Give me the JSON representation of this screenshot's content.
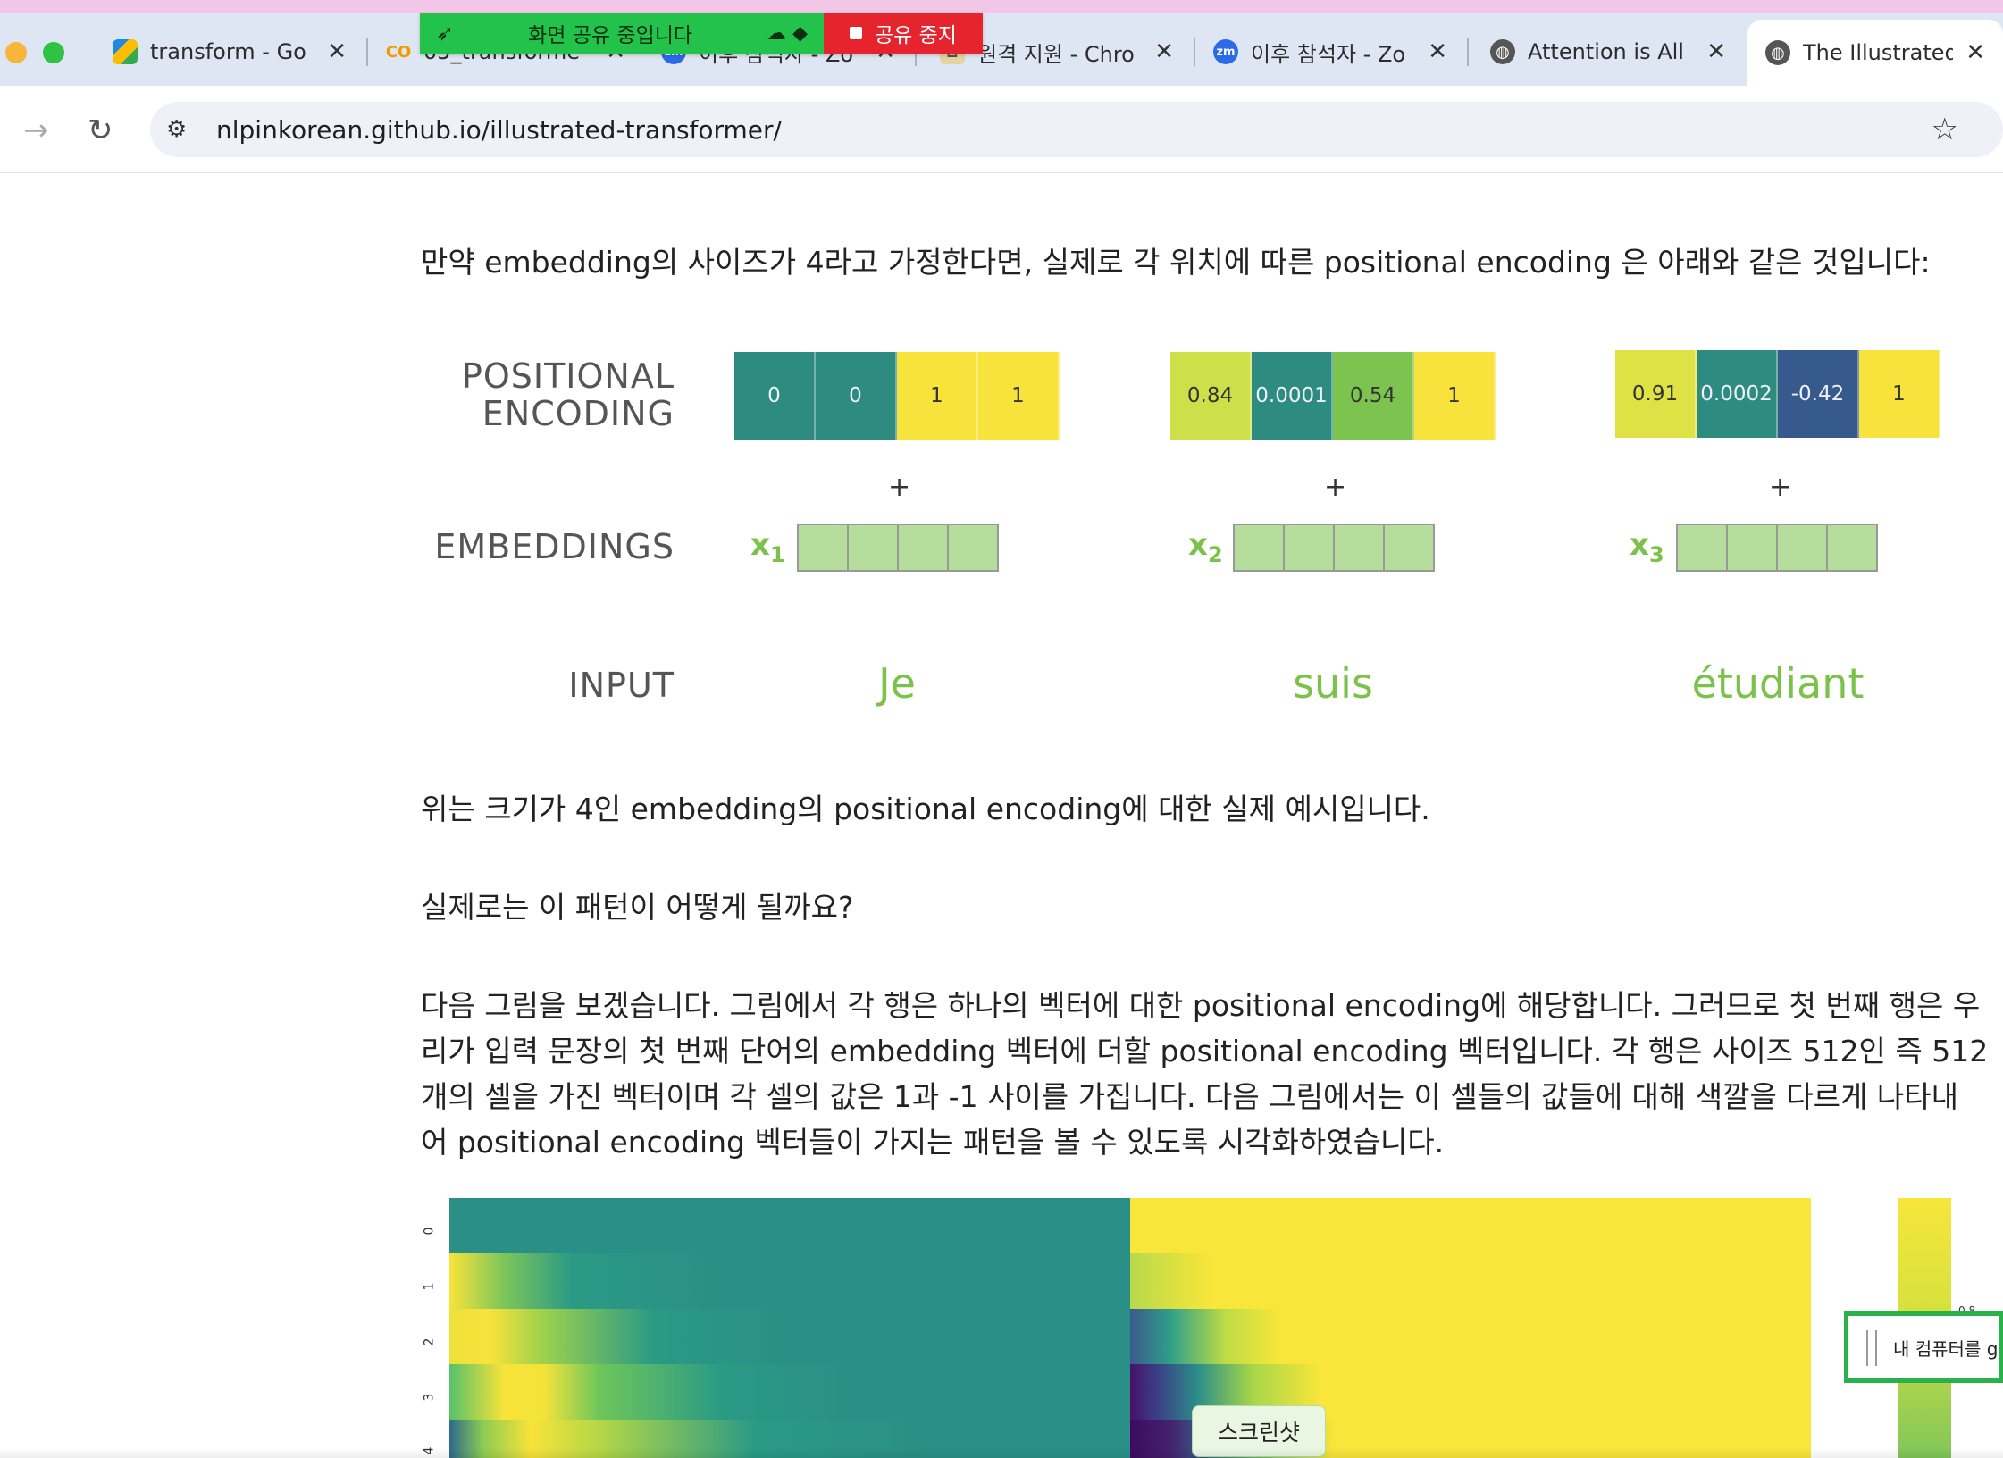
{
  "share_banner": {
    "status": "화면 공유 중입니다",
    "stop_label": "공유 중지"
  },
  "tabs": [
    {
      "title": "transform - Go",
      "icon": "google-drive-icon"
    },
    {
      "title": "05_transforme",
      "icon": "colab-icon",
      "icon_text": "CO"
    },
    {
      "title": "이후 참석자 - Zo",
      "icon": "zoom-icon",
      "icon_text": "zm"
    },
    {
      "title": "원격 지원 - Chro",
      "icon": "remote-desktop-icon"
    },
    {
      "title": "이후 참석자 - Zo",
      "icon": "zoom-icon",
      "icon_text": "zm"
    },
    {
      "title": "Attention is All",
      "icon": "globe-icon"
    },
    {
      "title": "The Illustrated",
      "icon": "globe-icon"
    }
  ],
  "address": {
    "url": "nlpinkorean.github.io/illustrated-transformer/"
  },
  "content": {
    "intro": "만약 embedding의 사이즈가 4라고 가정한다면, 실제로 각 위치에 따른 positional encoding 은 아래와 같은 것입니다:",
    "caption1": "위는 크기가 4인 embedding의 positional encoding에 대한 실제 예시입니다.",
    "caption2": "실제로는 이 패턴이 어떻게 될까요?",
    "para_lines": [
      "다음 그림을 보겠습니다. 그림에서 각 행은 하나의 벡터에 대한 positional encoding에 해당합니다. 그러므로 첫 번째 행은 우",
      "리가 입력 문장의 첫 번째 단어의 embedding 벡터에 더할 positional encoding 벡터입니다. 각 행은 사이즈 512인 즉 512",
      "개의 셀을 가진 벡터이며 각 셀의 값은 1과 -1 사이를 가집니다. 다음 그림에서는 이 셀들의 값들에 대해 색깔을 다르게 나타내",
      "어 positional encoding 벡터들이 가지는 패턴을 볼 수 있도록 시각화하였습니다."
    ]
  },
  "figure": {
    "label_pe_line1": "POSITIONAL",
    "label_pe_line2": "ENCODING",
    "label_emb": "EMBEDDINGS",
    "label_input": "INPUT",
    "plus": "+",
    "columns": [
      {
        "x_label": "x",
        "x_sub": "1",
        "word": "Je",
        "pe": [
          {
            "v": "0",
            "color": "#2e8b80"
          },
          {
            "v": "0",
            "color": "#2e8b80"
          },
          {
            "v": "1",
            "color": "#f8e23c"
          },
          {
            "v": "1",
            "color": "#f8e23c"
          }
        ]
      },
      {
        "x_label": "x",
        "x_sub": "2",
        "word": "suis",
        "pe": [
          {
            "v": "0.84",
            "color": "#cde04a"
          },
          {
            "v": "0.0001",
            "color": "#2e8b80"
          },
          {
            "v": "0.54",
            "color": "#7cc44f"
          },
          {
            "v": "1",
            "color": "#f8e23c"
          }
        ]
      },
      {
        "x_label": "x",
        "x_sub": "3",
        "word": "étudiant",
        "pe": [
          {
            "v": "0.91",
            "color": "#dfe244"
          },
          {
            "v": "0.0002",
            "color": "#2e8b80"
          },
          {
            "v": "-0.42",
            "color": "#365a8c"
          },
          {
            "v": "1",
            "color": "#f8e23c"
          }
        ]
      }
    ],
    "heatmap_ticks": [
      "0",
      "1",
      "2",
      "3",
      "4"
    ],
    "colorbar_tick": "0.8"
  },
  "overlays": {
    "popup_text": "내 컴퓨터를 g",
    "tooltip": "스크린샷"
  }
}
